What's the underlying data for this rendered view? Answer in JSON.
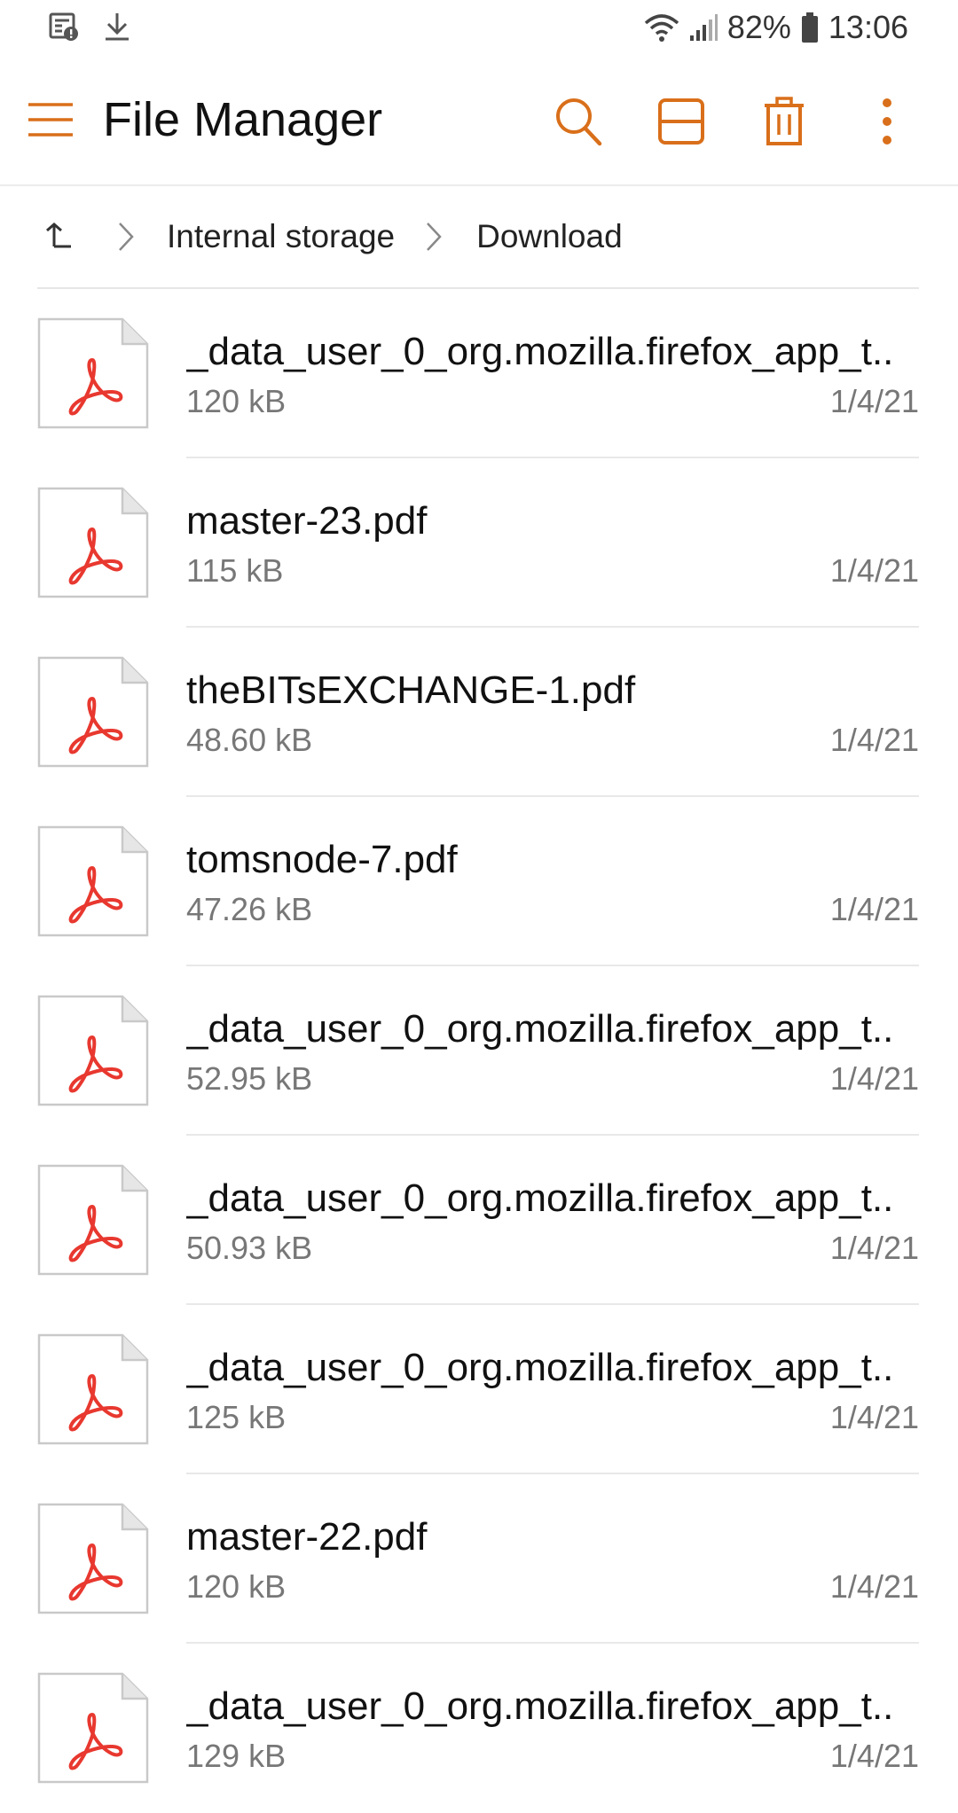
{
  "colors": {
    "accent": "#D96F1A",
    "pdf_red": "#E8382F",
    "text_primary": "#111111",
    "text_secondary": "#777777",
    "divider": "#E8E8E8"
  },
  "status_bar": {
    "left_icons": [
      "notification-icon",
      "download-icon"
    ],
    "battery_percent": "82%",
    "time": "13:06",
    "right_icons": [
      "wifi-icon",
      "signal-icon",
      "battery-icon"
    ]
  },
  "app_bar": {
    "title": "File Manager",
    "actions": [
      "search-icon",
      "view-layout-icon",
      "trash-icon",
      "more-vert-icon"
    ]
  },
  "breadcrumb": {
    "items": [
      "Internal storage",
      "Download"
    ]
  },
  "files": [
    {
      "name": "_data_user_0_org.mozilla.firefox_app_t..",
      "size": "120 kB",
      "date": "1/4/21"
    },
    {
      "name": "master-23.pdf",
      "size": "115 kB",
      "date": "1/4/21"
    },
    {
      "name": "theBITsEXCHANGE-1.pdf",
      "size": "48.60 kB",
      "date": "1/4/21"
    },
    {
      "name": "tomsnode-7.pdf",
      "size": "47.26 kB",
      "date": "1/4/21"
    },
    {
      "name": "_data_user_0_org.mozilla.firefox_app_t..",
      "size": "52.95 kB",
      "date": "1/4/21"
    },
    {
      "name": "_data_user_0_org.mozilla.firefox_app_t..",
      "size": "50.93 kB",
      "date": "1/4/21"
    },
    {
      "name": "_data_user_0_org.mozilla.firefox_app_t..",
      "size": "125 kB",
      "date": "1/4/21"
    },
    {
      "name": "master-22.pdf",
      "size": "120 kB",
      "date": "1/4/21"
    },
    {
      "name": "_data_user_0_org.mozilla.firefox_app_t..",
      "size": "129 kB",
      "date": "1/4/21"
    }
  ]
}
